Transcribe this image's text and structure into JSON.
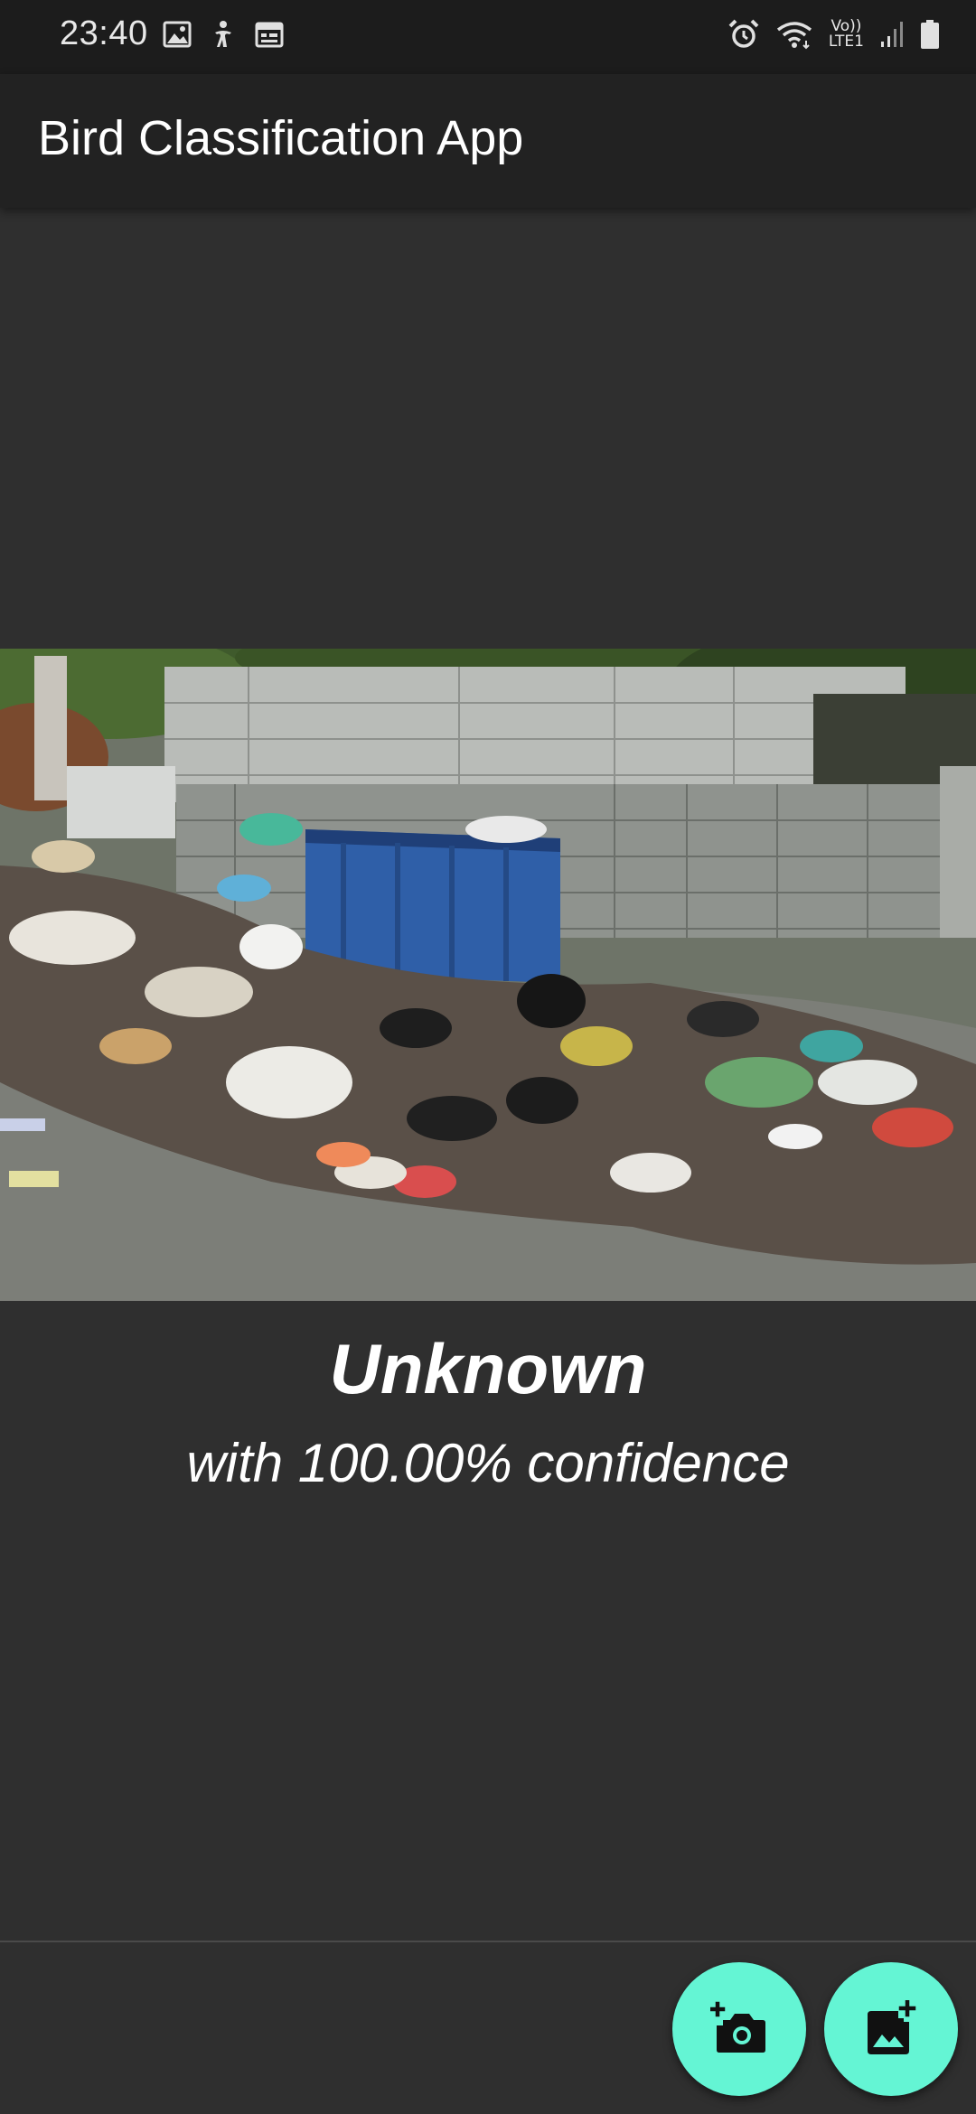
{
  "status_bar": {
    "time": "23:40",
    "network_label_top": "Vo))",
    "network_label_bottom": "LTE1",
    "left_icons": [
      "image-icon",
      "accessibility-icon",
      "calendar-icon"
    ],
    "right_icons": [
      "alarm-icon",
      "wifi-icon",
      "lte-signal-icon",
      "battery-icon"
    ]
  },
  "app_bar": {
    "title": "Bird Classification App"
  },
  "result": {
    "label": "Unknown",
    "confidence_text": "with 100.00% confidence"
  },
  "actions": {
    "camera_icon": "add-camera-icon",
    "gallery_icon": "add-photo-icon",
    "accent_color": "#64f5d4"
  }
}
